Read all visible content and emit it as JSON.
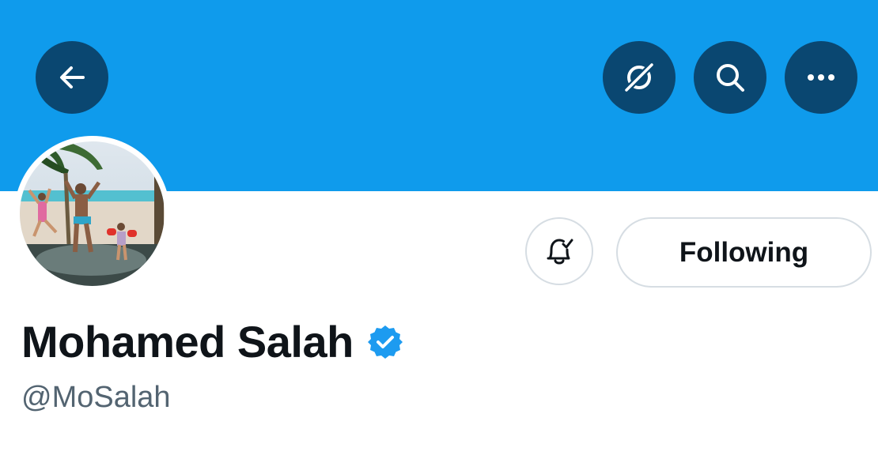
{
  "header": {
    "back_icon": "arrow-left-icon",
    "translate_icon": "translate-icon",
    "search_icon": "search-icon",
    "more_icon": "more-horizontal-icon",
    "banner_color": "#0f9bec",
    "button_color": "#0a4771"
  },
  "profile": {
    "display_name": "Mohamed Salah",
    "handle": "@MoSalah",
    "verified": true,
    "verified_icon": "verified-badge-icon",
    "verified_color": "#1d9bf0",
    "avatar": "profile-photo"
  },
  "actions": {
    "notifications_icon": "bell-check-icon",
    "follow_label": "Following"
  }
}
